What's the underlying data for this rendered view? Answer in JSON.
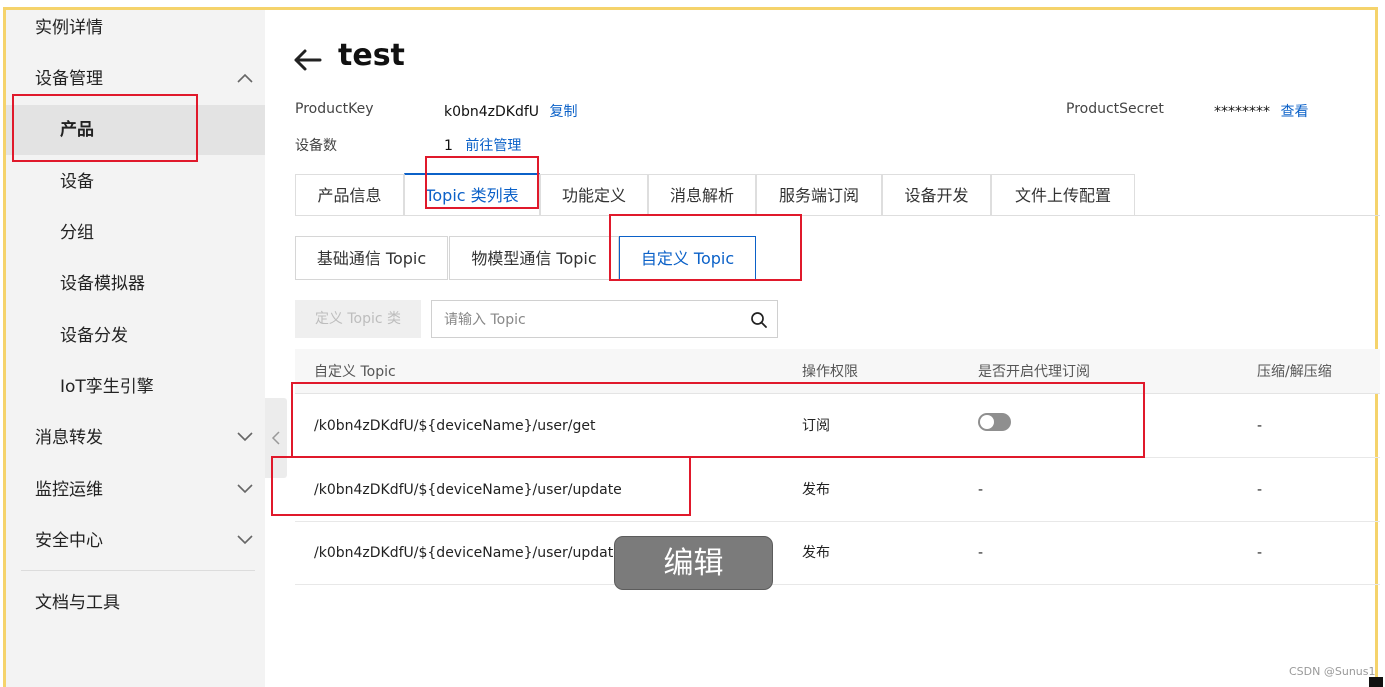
{
  "sidebar": {
    "items": [
      {
        "label": "实例详情"
      },
      {
        "label": "设备管理"
      },
      {
        "label": "产品"
      },
      {
        "label": "设备"
      },
      {
        "label": "分组"
      },
      {
        "label": "设备模拟器"
      },
      {
        "label": "设备分发"
      },
      {
        "label": "IoT孪生引擎"
      },
      {
        "label": "消息转发"
      },
      {
        "label": "监控运维"
      },
      {
        "label": "安全中心"
      },
      {
        "label": "文档与工具"
      }
    ]
  },
  "header": {
    "title": "test",
    "product_key_label": "ProductKey",
    "product_key_value": "k0bn4zDKdfU",
    "copy_link": "复制",
    "device_count_label": "设备数",
    "device_count_value": "1",
    "manage_link": "前往管理",
    "secret_label": "ProductSecret",
    "secret_value": "********",
    "view_link": "查看"
  },
  "tabs": [
    {
      "label": "产品信息"
    },
    {
      "label": "Topic 类列表"
    },
    {
      "label": "功能定义"
    },
    {
      "label": "消息解析"
    },
    {
      "label": "服务端订阅"
    },
    {
      "label": "设备开发"
    },
    {
      "label": "文件上传配置"
    }
  ],
  "subtabs": [
    {
      "label": "基础通信 Topic"
    },
    {
      "label": "物模型通信 Topic"
    },
    {
      "label": "自定义 Topic"
    }
  ],
  "toolbar": {
    "define_button": "定义 Topic 类",
    "search_placeholder": "请输入 Topic"
  },
  "table": {
    "headers": [
      "自定义 Topic",
      "操作权限",
      "是否开启代理订阅",
      "压缩/解压缩"
    ],
    "rows": [
      {
        "topic": "/k0bn4zDKdfU/${deviceName}/user/get",
        "permission": "订阅",
        "proxy": "",
        "compress": "-"
      },
      {
        "topic": "/k0bn4zDKdfU/${deviceName}/user/update",
        "permission": "发布",
        "proxy": "-",
        "compress": "-"
      },
      {
        "topic": "/k0bn4zDKdfU/${deviceName}/user/update/error",
        "permission": "发布",
        "proxy": "-",
        "compress": "-"
      }
    ]
  },
  "tooltip": "编辑",
  "watermark": "CSDN @Sunus1",
  "colors": {
    "accent": "#0b61c8",
    "annotation": "#e0192b",
    "frame": "#f5d36b"
  }
}
